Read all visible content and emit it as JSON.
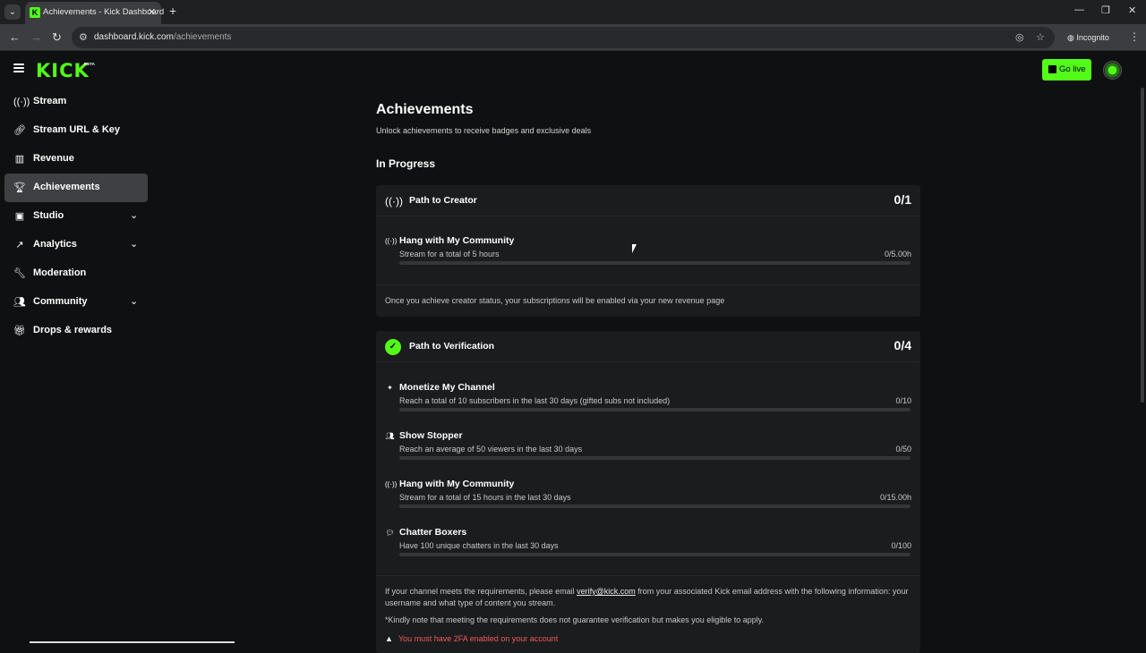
{
  "browser": {
    "tab_title": "Achievements - Kick Dashboard",
    "url_host": "dashboard.kick.com",
    "url_path": "/achievements",
    "incognito_label": "Incognito"
  },
  "header": {
    "logo": "KICK",
    "logo_badge": "BETA",
    "go_live_label": "Go live"
  },
  "sidebar": {
    "items": [
      {
        "label": "Stream",
        "icon": "broadcast-icon"
      },
      {
        "label": "Stream URL & Key",
        "icon": "link-icon"
      },
      {
        "label": "Revenue",
        "icon": "chart-icon"
      },
      {
        "label": "Achievements",
        "icon": "trophy-icon",
        "active": true
      },
      {
        "label": "Studio",
        "icon": "studio-icon",
        "expandable": true
      },
      {
        "label": "Analytics",
        "icon": "analytics-icon",
        "expandable": true
      },
      {
        "label": "Moderation",
        "icon": "wrench-icon"
      },
      {
        "label": "Community",
        "icon": "community-icon",
        "expandable": true
      },
      {
        "label": "Drops & rewards",
        "icon": "gift-icon"
      }
    ]
  },
  "main": {
    "title": "Achievements",
    "subtitle": "Unlock achievements to receive badges and exclusive deals",
    "section_title": "In Progress",
    "creator": {
      "title": "Path to Creator",
      "count": "0/1",
      "achievements": [
        {
          "title": "Hang with My Community",
          "desc": "Stream for a total of 5 hours",
          "value": "0/5.00h",
          "progress": 0
        }
      ],
      "footer": "Once you achieve creator status, your subscriptions will be enabled via your new revenue page"
    },
    "verification": {
      "title": "Path to Verification",
      "count": "0/4",
      "achievements": [
        {
          "title": "Monetize My Channel",
          "desc": "Reach a total of 10 subscribers in the last 30 days (gifted subs not included)",
          "value": "0/10",
          "progress": 0
        },
        {
          "title": "Show Stopper",
          "desc": "Reach an average of 50 viewers in the last 30 days",
          "value": "0/50",
          "progress": 0
        },
        {
          "title": "Hang with My Community",
          "desc": "Stream for a total of 15 hours in the last 30 days",
          "value": "0/15.00h",
          "progress": 0
        },
        {
          "title": "Chatter Boxers",
          "desc": "Have 100 unique chatters in the last 30 days",
          "value": "0/100",
          "progress": 0
        }
      ],
      "footer_before": "If your channel meets the requirements, please email ",
      "footer_email": "verify@kick.com",
      "footer_after": " from your associated Kick email address with the following information: your username and what type of content you stream.",
      "footer_note": "*Kindly note that meeting the requirements does not guarantee verification but makes you eligible to apply.",
      "warning": "You must have 2FA enabled on your account"
    }
  }
}
